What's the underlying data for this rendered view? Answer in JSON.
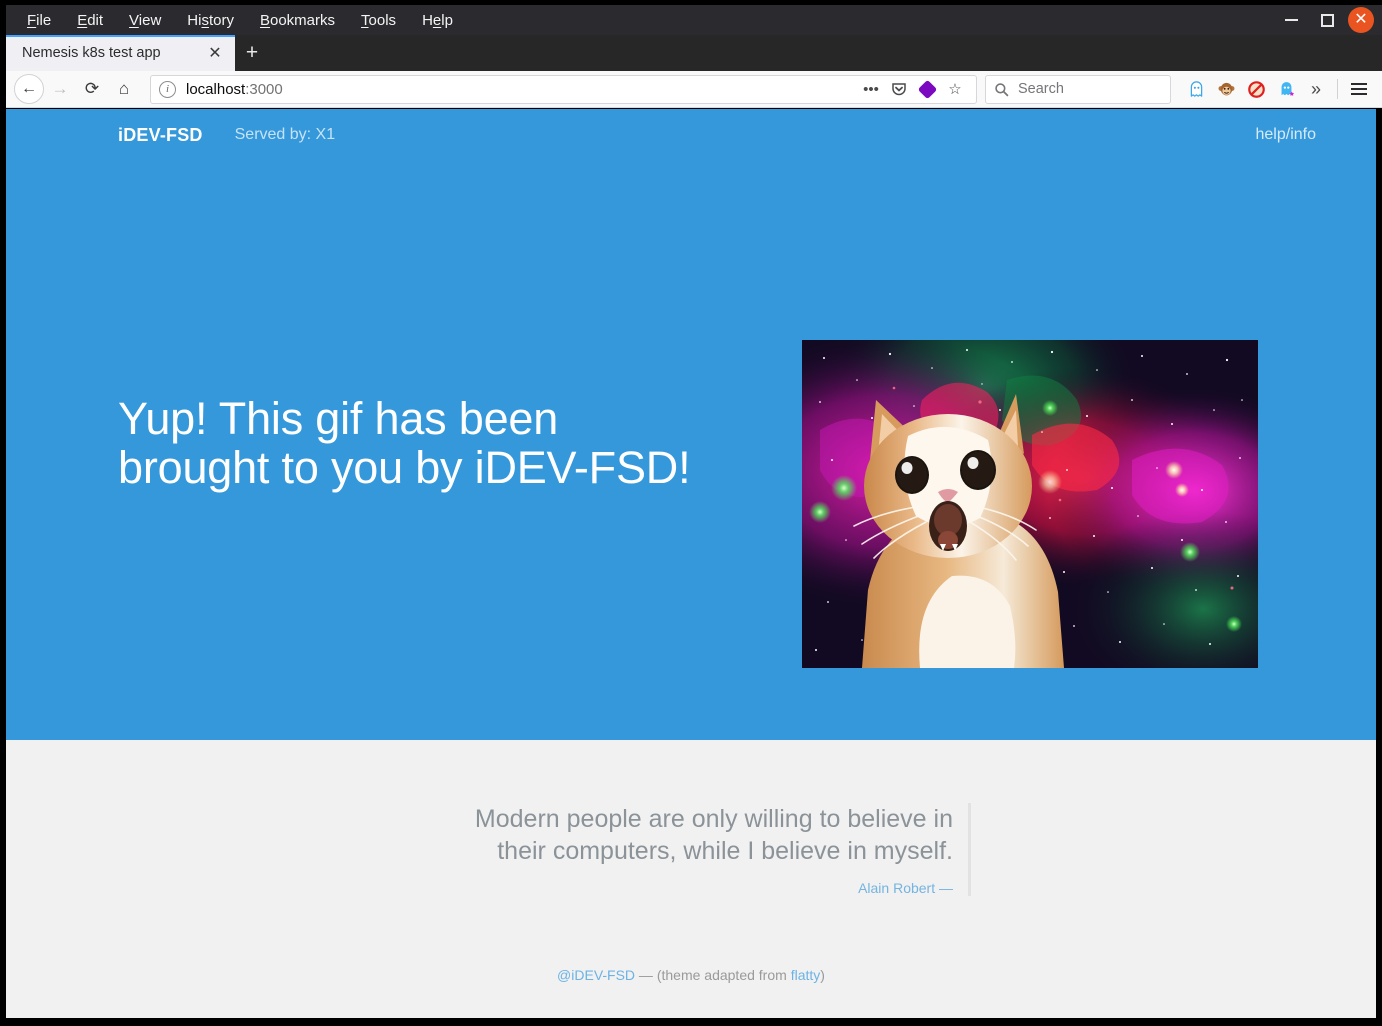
{
  "browser": {
    "menu_items": [
      {
        "label": "File",
        "accel": "F"
      },
      {
        "label": "Edit",
        "accel": "E"
      },
      {
        "label": "View",
        "accel": "V"
      },
      {
        "label": "History",
        "accel": "s"
      },
      {
        "label": "Bookmarks",
        "accel": "B"
      },
      {
        "label": "Tools",
        "accel": "T"
      },
      {
        "label": "Help",
        "accel": "e"
      }
    ],
    "window_controls": {
      "minimize": "minimize-button",
      "maximize": "maximize-button",
      "close": "close-button",
      "close_glyph": "✕",
      "close_color": "#e95420"
    },
    "overlay": {
      "grid_dots": "app-grid-icon",
      "purple_badge_glyph": "∞",
      "purple_badge_color": "#7a09bf"
    },
    "tab": {
      "title": "Nemesis k8s test app",
      "close_glyph": "✕",
      "new_tab_glyph": "+",
      "active_indicator_color": "#45a1ff"
    },
    "nav": {
      "back_glyph": "←",
      "forward_glyph": "→",
      "reload_glyph": "⟳",
      "home_glyph": "⌂"
    },
    "url": {
      "host": "localhost",
      "port": ":3000",
      "info_glyph": "i",
      "actions": {
        "page_actions_glyph": "•••",
        "pocket_glyph": "▽",
        "container_glyph": "container-icon",
        "bookmark_glyph": "☆"
      }
    },
    "search": {
      "placeholder": "Search",
      "icon_glyph": "⌕"
    },
    "extensions": [
      {
        "name": "ghost-outline-extension-icon",
        "glyph": "👻"
      },
      {
        "name": "monkey-extension-icon",
        "glyph": "🐵"
      },
      {
        "name": "blocker-extension-icon",
        "glyph": "🚫"
      },
      {
        "name": "ghost-star-extension-icon",
        "glyph": "👻"
      }
    ],
    "overflow_glyph": "»",
    "menu_glyph": "hamburger-menu-icon"
  },
  "page": {
    "colors": {
      "hero_background": "#3498db",
      "body_background": "#f1f1f1",
      "link": "#6cb3e4",
      "quote_text": "#8b9399"
    },
    "header": {
      "brand": "iDEV-FSD",
      "served_by": "Served by: X1",
      "help_link": "help/info"
    },
    "hero": {
      "headline_line1": "Yup! This gif has been",
      "headline_line2": "brought to you by iDEV-FSD!",
      "image_alt": "surprised-cat-in-space-gif"
    },
    "quote": {
      "text_line1": "Modern people are only willing to believe in their",
      "text_line2": "computers, while I believe in myself.",
      "author": "Alain Robert —"
    },
    "footer": {
      "handle": "@iDEV-FSD",
      "separator": " — (theme adapted from ",
      "theme_link": "flatty",
      "closing": ")"
    }
  }
}
